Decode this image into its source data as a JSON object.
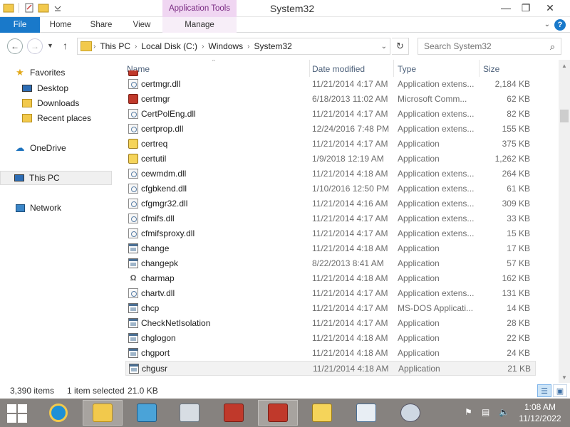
{
  "window": {
    "title": "System32",
    "contextual_tab_group": "Application Tools",
    "controls": {
      "minimize": "—",
      "maximize": "❐",
      "close": "✕"
    }
  },
  "ribbon": {
    "tabs": [
      "File",
      "Home",
      "Share",
      "View",
      "Manage"
    ],
    "help": "?"
  },
  "address": {
    "breadcrumbs": [
      "This PC",
      "Local Disk (C:)",
      "Windows",
      "System32"
    ],
    "search_placeholder": "Search System32"
  },
  "nav_pane": {
    "favorites": "Favorites",
    "desktop": "Desktop",
    "downloads": "Downloads",
    "recent_places": "Recent places",
    "onedrive": "OneDrive",
    "this_pc": "This PC",
    "network": "Network"
  },
  "columns": {
    "name": "Name",
    "date": "Date modified",
    "type": "Type",
    "size": "Size"
  },
  "files": [
    {
      "name": "certmgr.dll",
      "date": "11/21/2014 4:17 AM",
      "type": "Application extens...",
      "size": "2,184 KB",
      "icon": "dll-icon"
    },
    {
      "name": "certmgr",
      "date": "6/18/2013 11:02 AM",
      "type": "Microsoft Comm...",
      "size": "62 KB",
      "icon": "msc-icon"
    },
    {
      "name": "CertPolEng.dll",
      "date": "11/21/2014 4:17 AM",
      "type": "Application extens...",
      "size": "82 KB",
      "icon": "dll-icon"
    },
    {
      "name": "certprop.dll",
      "date": "12/24/2016 7:48 PM",
      "type": "Application extens...",
      "size": "155 KB",
      "icon": "dll-icon"
    },
    {
      "name": "certreq",
      "date": "11/21/2014 4:17 AM",
      "type": "Application",
      "size": "375 KB",
      "icon": "key-icon"
    },
    {
      "name": "certutil",
      "date": "1/9/2018 12:19 AM",
      "type": "Application",
      "size": "1,262 KB",
      "icon": "key-icon"
    },
    {
      "name": "cewmdm.dll",
      "date": "11/21/2014 4:18 AM",
      "type": "Application extens...",
      "size": "264 KB",
      "icon": "dll-icon"
    },
    {
      "name": "cfgbkend.dll",
      "date": "1/10/2016 12:50 PM",
      "type": "Application extens...",
      "size": "61 KB",
      "icon": "dll-icon"
    },
    {
      "name": "cfgmgr32.dll",
      "date": "11/21/2014 4:16 AM",
      "type": "Application extens...",
      "size": "309 KB",
      "icon": "dll-icon"
    },
    {
      "name": "cfmifs.dll",
      "date": "11/21/2014 4:17 AM",
      "type": "Application extens...",
      "size": "33 KB",
      "icon": "dll-icon"
    },
    {
      "name": "cfmifsproxy.dll",
      "date": "11/21/2014 4:17 AM",
      "type": "Application extens...",
      "size": "15 KB",
      "icon": "dll-icon"
    },
    {
      "name": "change",
      "date": "11/21/2014 4:18 AM",
      "type": "Application",
      "size": "17 KB",
      "icon": "app-icon"
    },
    {
      "name": "changepk",
      "date": "8/22/2013 8:41 AM",
      "type": "Application",
      "size": "57 KB",
      "icon": "app-icon"
    },
    {
      "name": "charmap",
      "date": "11/21/2014 4:18 AM",
      "type": "Application",
      "size": "162 KB",
      "icon": "charmap-icon"
    },
    {
      "name": "chartv.dll",
      "date": "11/21/2014 4:17 AM",
      "type": "Application extens...",
      "size": "131 KB",
      "icon": "dll-icon"
    },
    {
      "name": "chcp",
      "date": "11/21/2014 4:17 AM",
      "type": "MS-DOS Applicati...",
      "size": "14 KB",
      "icon": "app-icon"
    },
    {
      "name": "CheckNetIsolation",
      "date": "11/21/2014 4:17 AM",
      "type": "Application",
      "size": "28 KB",
      "icon": "app-icon"
    },
    {
      "name": "chglogon",
      "date": "11/21/2014 4:18 AM",
      "type": "Application",
      "size": "22 KB",
      "icon": "app-icon"
    },
    {
      "name": "chgport",
      "date": "11/21/2014 4:18 AM",
      "type": "Application",
      "size": "24 KB",
      "icon": "app-icon"
    },
    {
      "name": "chgusr",
      "date": "11/21/2014 4:18 AM",
      "type": "Application",
      "size": "21 KB",
      "icon": "app-icon",
      "selected": true
    }
  ],
  "status": {
    "item_count": "3,390 items",
    "selection": "1 item selected",
    "selection_size": "21.0 KB"
  },
  "taskbar": {
    "pinned": [
      "internet-explorer-icon",
      "file-explorer-icon",
      "registry-icon",
      "calculator-icon",
      "toolbox-icon",
      "toolbox-icon",
      "key-app-icon",
      "window-app-icon",
      "powershell-icon"
    ],
    "time": "1:08 AM",
    "date": "11/12/2022"
  },
  "colors": {
    "file_tab": "#1979ca",
    "contextual_tab": "#f0d6f2",
    "taskbar": "#86827f",
    "header_text": "#4c607a"
  }
}
